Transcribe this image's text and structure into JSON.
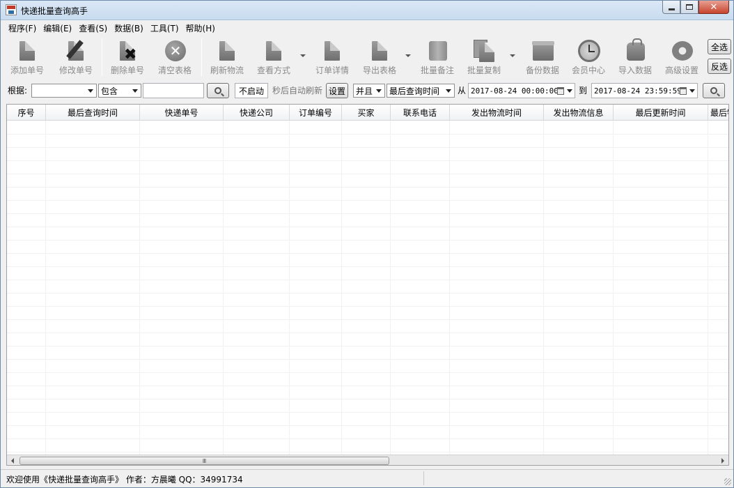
{
  "window": {
    "title": "快递批量查询高手",
    "close_glyph": "✕"
  },
  "menu": [
    {
      "id": "program",
      "label": "程序(F)"
    },
    {
      "id": "edit",
      "label": "编辑(E)"
    },
    {
      "id": "view",
      "label": "查看(S)"
    },
    {
      "id": "data",
      "label": "数据(B)"
    },
    {
      "id": "tools",
      "label": "工具(T)"
    },
    {
      "id": "help",
      "label": "帮助(H)"
    }
  ],
  "toolbar": {
    "add": "添加单号",
    "modify": "修改单号",
    "delete": "删除单号",
    "clear": "清空表格",
    "refresh": "刷新物流",
    "view_mode": "查看方式",
    "order_detail": "订单详情",
    "export": "导出表格",
    "batch_note": "批量备注",
    "batch_copy": "批量复制",
    "backup": "备份数据",
    "member": "会员中心",
    "import": "导入数据",
    "advanced": "高级设置",
    "select_all": "全选",
    "invert": "反选"
  },
  "icons": {
    "add": "document-icon",
    "modify": "edit-pencil-icon",
    "delete": "delete-x-icon",
    "clear": "clear-circle-x-icon",
    "refresh": "document-refresh-icon",
    "view_mode": "document-view-icon",
    "order_detail": "document-detail-icon",
    "export": "export-icon",
    "batch_note": "scroll-note-icon",
    "batch_copy": "copy-icon",
    "backup": "backup-box-icon",
    "member": "clock-icon",
    "import": "bag-icon",
    "advanced": "gear-icon",
    "search": "magnifier-icon",
    "calendar": "calendar-icon"
  },
  "filter": {
    "by_label": "根据:",
    "field_value": "",
    "match_mode": "包含",
    "keyword": "",
    "auto_refresh_value": "不启动",
    "auto_refresh_label": "秒后自动刷新",
    "settings_button": "设置",
    "logic": "并且",
    "time_field": "最后查询时间",
    "from_label": "从",
    "from_date": "2017-08-24 00:00:00",
    "to_label": "到",
    "to_date": "2017-08-24 23:59:59"
  },
  "table": {
    "columns": [
      "序号",
      "最后查询时间",
      "快递单号",
      "快递公司",
      "订单编号",
      "买家",
      "联系电话",
      "发出物流时间",
      "发出物流信息",
      "最后更新时间",
      "最后物"
    ],
    "rows": []
  },
  "scrollbar": {
    "thumb_grip": "Ⅲ",
    "position": 0
  },
  "status": {
    "text": "欢迎使用《快递批量查询高手》 作者：方晨曦  QQ：34991734"
  }
}
